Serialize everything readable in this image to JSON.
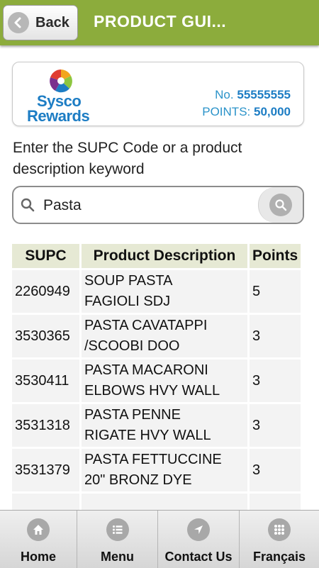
{
  "header": {
    "back_label": "Back",
    "title": "PRODUCT GUI..."
  },
  "card": {
    "logo_line1": "Sysco",
    "logo_line2": "Rewards",
    "number_label": "No.",
    "number_value": "55555555",
    "points_label": "POINTS:",
    "points_value": "50,000"
  },
  "instructions": "Enter the SUPC Code or a product description keyword",
  "search": {
    "value": "Pasta"
  },
  "table": {
    "headers": [
      "SUPC",
      "Product Description",
      "Points"
    ],
    "rows": [
      {
        "supc": "2260949",
        "desc1": "SOUP PASTA",
        "desc2": "FAGIOLI SDJ",
        "points": "5"
      },
      {
        "supc": "3530365",
        "desc1": "PASTA CAVATAPPI",
        "desc2": "/SCOOBI DOO",
        "points": "3"
      },
      {
        "supc": "3530411",
        "desc1": "PASTA MACARONI",
        "desc2": "ELBOWS HVY WALL",
        "points": "3"
      },
      {
        "supc": "3531318",
        "desc1": "PASTA PENNE",
        "desc2": "RIGATE HVY WALL",
        "points": "3"
      },
      {
        "supc": "3531379",
        "desc1": "PASTA FETTUCCINE",
        "desc2": "20\" BRONZ DYE",
        "points": "3"
      },
      {
        "supc": "",
        "desc1": "",
        "desc2": "",
        "points": ""
      }
    ]
  },
  "nav": [
    {
      "label": "Home",
      "icon": "home-icon"
    },
    {
      "label": "Menu",
      "icon": "list-icon"
    },
    {
      "label": "Contact Us",
      "icon": "location-arrow-icon"
    },
    {
      "label": "Français",
      "icon": "grid-icon"
    }
  ],
  "colors": {
    "header_bg": "#8cac3c",
    "brand_blue": "#1d7dc4",
    "table_header_bg": "#e6e9d4",
    "table_cell_bg": "#f3f3f3"
  }
}
